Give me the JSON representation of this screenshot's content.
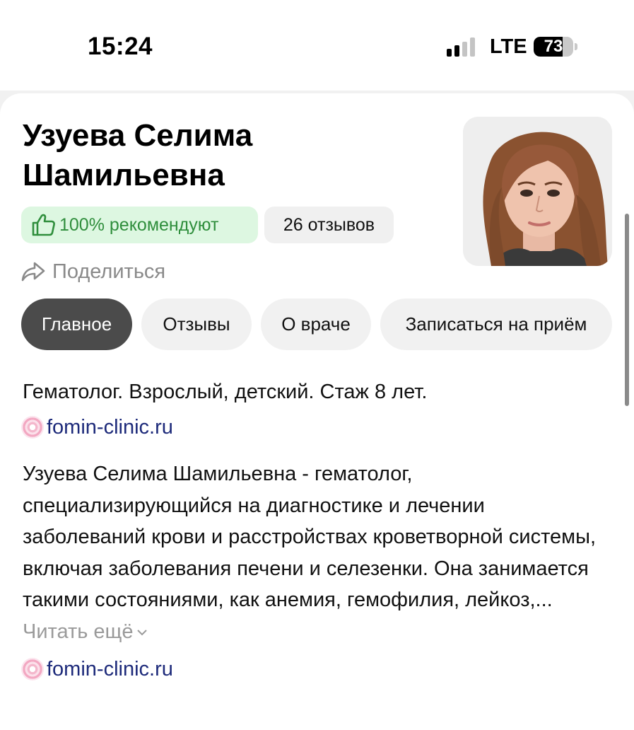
{
  "status_bar": {
    "time": "15:24",
    "network": "LTE",
    "battery_percent": "73",
    "battery_level": 0.73,
    "signal_bars": 2
  },
  "doctor": {
    "name": "Узуева Селима Шамильевна",
    "recommend_label": "100% рекомендуют",
    "reviews_label": "26 отзывов",
    "share_label": "Поделиться"
  },
  "tabs": [
    {
      "label": "Главное",
      "active": true
    },
    {
      "label": "Отзывы",
      "active": false
    },
    {
      "label": "О враче",
      "active": false
    },
    {
      "label": "Записаться на приём",
      "active": false
    }
  ],
  "info": {
    "subtitle": "Гематолог. Взрослый, детский. Стаж 8 лет.",
    "site_top": "fomin-clinic.ru",
    "description": "Узуева Селима Шамильевна - гематолог, специализирующийся на диагностике и лечении заболеваний крови и расстройствах кроветворной системы, включая заболевания печени и селезенки. Она занимается такими состояниями, как анемия, гемофилия, лейкоз,...",
    "read_more": "Читать ещё",
    "site_bottom": "fomin-clinic.ru"
  },
  "colors": {
    "recommend_bg": "#ddf7e1",
    "recommend_text": "#2f8e3c",
    "active_tab": "#4b4b4b",
    "link": "#1d2a7a"
  }
}
